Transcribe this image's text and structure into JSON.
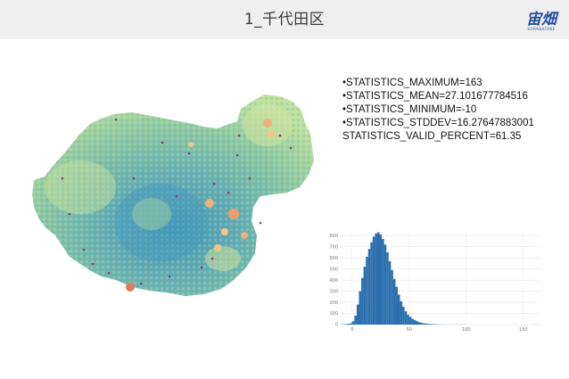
{
  "header": {
    "title": "1_千代田区",
    "logo_text": "宙畑",
    "logo_sub": "SORABATAKE"
  },
  "stats": {
    "lines": [
      "•STATISTICS_MAXIMUM=163",
      "•STATISTICS_MEAN=27.101677784516",
      "•STATISTICS_MINIMUM=-10",
      "•STATISTICS_STDDEV=16.27647883001",
      "STATISTICS_VALID_PERCENT=61.35"
    ]
  },
  "colors": {
    "header_bg": "#efefef",
    "bar": "#2b6fae",
    "map_low": "#3f93b8",
    "map_mid": "#7fc3a6",
    "map_high": "#d6e79a",
    "hot": "#f0b07a"
  },
  "chart_data": {
    "type": "bar",
    "title": "",
    "xlabel": "",
    "ylabel": "",
    "xlim": [
      -10,
      165
    ],
    "ylim": [
      0,
      850
    ],
    "x_ticks": [
      "0",
      "50",
      "100",
      "150"
    ],
    "y_ticks": [
      "0",
      "100",
      "200",
      "300",
      "400",
      "500",
      "600",
      "700",
      "800"
    ],
    "bins": [
      -10,
      -8,
      -6,
      -4,
      -2,
      0,
      2,
      4,
      6,
      8,
      10,
      12,
      14,
      16,
      18,
      20,
      22,
      24,
      26,
      28,
      30,
      32,
      34,
      36,
      38,
      40,
      42,
      44,
      46,
      48,
      50,
      52,
      54,
      56,
      58,
      60,
      62,
      64,
      66,
      68,
      70,
      72,
      74,
      76,
      78,
      80,
      85,
      90,
      100,
      110,
      120,
      130,
      140,
      150,
      160
    ],
    "values": [
      2,
      3,
      5,
      8,
      12,
      30,
      80,
      180,
      300,
      420,
      520,
      610,
      680,
      740,
      790,
      820,
      830,
      810,
      770,
      720,
      650,
      570,
      490,
      410,
      340,
      270,
      210,
      160,
      120,
      90,
      70,
      52,
      40,
      30,
      22,
      16,
      12,
      9,
      7,
      5,
      4,
      3,
      2,
      2,
      1,
      1,
      1,
      1,
      0,
      0,
      0,
      0,
      0,
      0,
      1
    ]
  }
}
